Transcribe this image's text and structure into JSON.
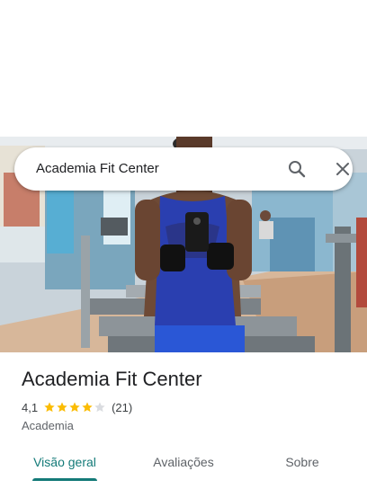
{
  "search": {
    "query": "Academia Fit Center"
  },
  "place": {
    "name": "Academia Fit Center",
    "rating": "4,1",
    "rating_stars": 4.1,
    "review_count": "(21)",
    "category": "Academia"
  },
  "tabs": [
    {
      "label": "Visão geral",
      "active": true
    },
    {
      "label": "Avaliações",
      "active": false
    },
    {
      "label": "Sobre",
      "active": false
    }
  ],
  "colors": {
    "accent": "#137a78",
    "star": "#fbbc04",
    "star_empty": "#dadce0"
  },
  "icons": {
    "search": "search-icon",
    "close": "close-icon",
    "star": "star-icon"
  }
}
